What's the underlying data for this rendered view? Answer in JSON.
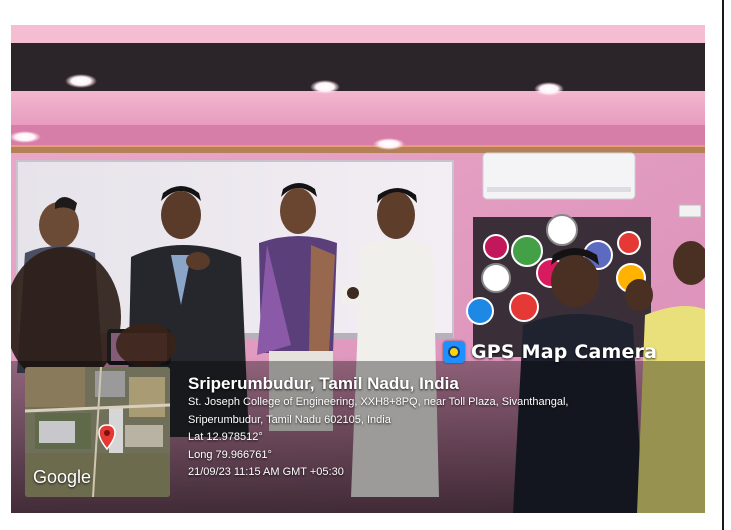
{
  "overlay": {
    "app_badge": "GPS Map Camera",
    "location_title": "Sriperumbudur, Tamil Nadu, India",
    "address_line1": "St. Joseph College of Engineering, XXH8+8PQ, near Toll Plaza, Sivanthangal,",
    "address_line2": "Sriperumbudur, Tamil Nadu 602105, India",
    "latitude": "Lat 12.978512°",
    "longitude": "Long 79.966761°",
    "timestamp": "21/09/23 11:15 AM GMT +05:30",
    "map_provider": "Google"
  },
  "colors": {
    "wall": "#e7a0c6",
    "ceiling": "#f0a8c8",
    "map_pin": "#e53935",
    "badge_icon": "#1e90ff"
  }
}
